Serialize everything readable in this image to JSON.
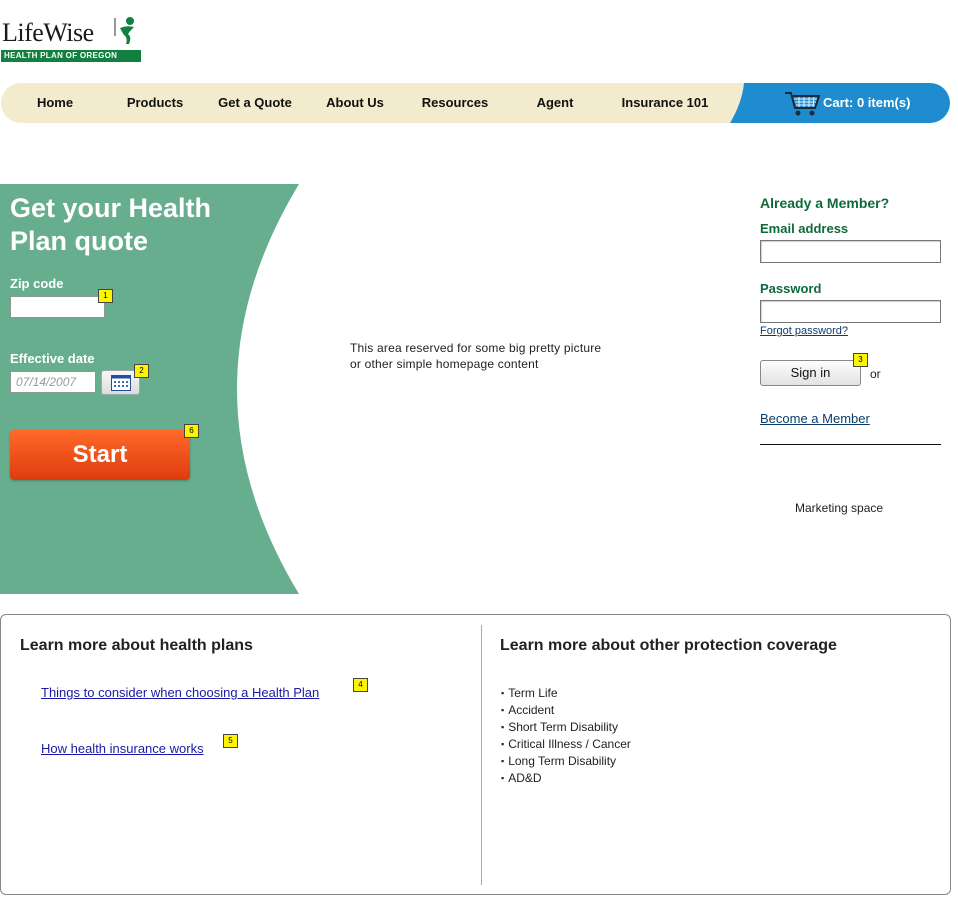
{
  "brand": {
    "name": "LifeWise",
    "subtitle": "HEALTH PLAN OF OREGON",
    "green": "#12813f"
  },
  "nav": {
    "items": [
      "Home",
      "Products",
      "Get a Quote",
      "About Us",
      "Resources",
      "Agent",
      "Insurance 101"
    ],
    "cart_label": "Cart: 0 item(s)",
    "bar_color": "#f3ebcd",
    "cart_color": "#1f8ccf"
  },
  "quote": {
    "title": "Get your Health Plan quote",
    "zip_label": "Zip code",
    "zip_value": "",
    "date_label": "Effective date",
    "date_value": "07/14/2007",
    "start_label": "Start",
    "panel_color": "#67ae8f",
    "badges": {
      "zip": "1",
      "calendar": "2",
      "start": "6"
    }
  },
  "main": {
    "reserved_text": "This area reserved for some big pretty picture or other simple homepage content"
  },
  "member": {
    "title": "Already a Member?",
    "email_label": "Email address",
    "password_label": "Password",
    "forgot_label": "Forgot password?",
    "signin_label": "Sign in",
    "signin_badge": "3",
    "or_text": "or",
    "become_label": "Become a Member",
    "marketing_text": "Marketing space"
  },
  "learn": {
    "health_heading": "Learn more about health plans",
    "links": [
      {
        "label": "Things to consider when choosing a Health Plan",
        "badge": "4"
      },
      {
        "label": "How health insurance works",
        "badge": "5"
      }
    ],
    "other_heading": "Learn more about other protection coverage",
    "other_items": [
      "Term Life",
      "Accident",
      "Short Term Disability",
      "Critical Illness / Cancer",
      "Long Term Disability",
      "AD&D"
    ]
  }
}
